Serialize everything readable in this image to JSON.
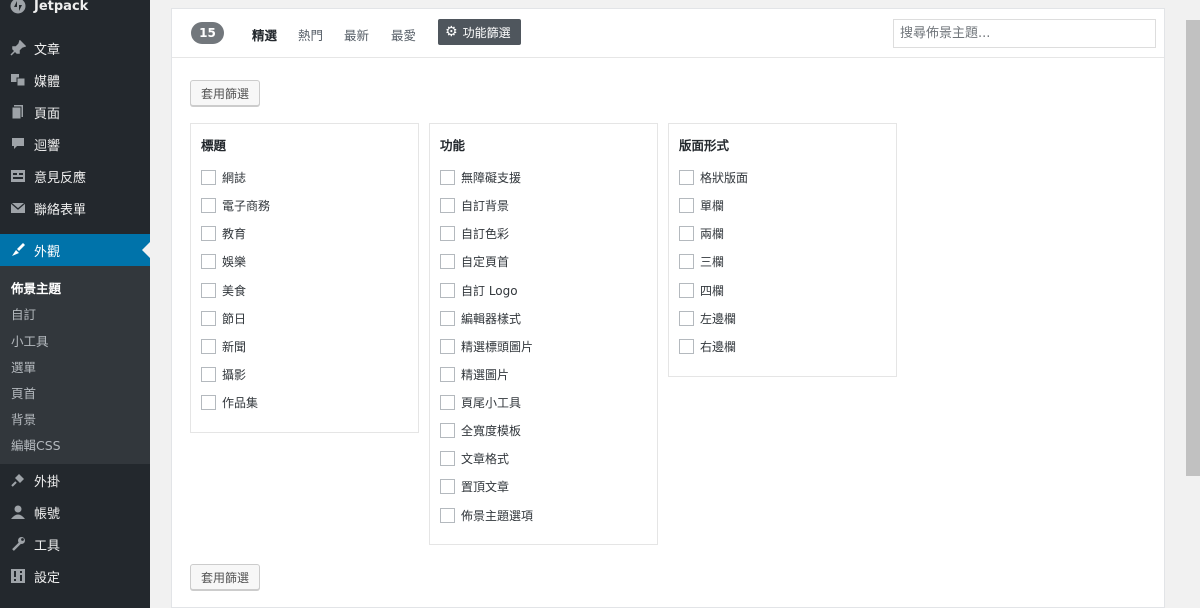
{
  "sidebar": {
    "jetpack": "Jetpack",
    "items": [
      {
        "label": "文章",
        "icon": "pin-icon"
      },
      {
        "label": "媒體",
        "icon": "media-icon"
      },
      {
        "label": "頁面",
        "icon": "page-icon"
      },
      {
        "label": "迴響",
        "icon": "comment-icon"
      },
      {
        "label": "意見反應",
        "icon": "feedback-icon"
      },
      {
        "label": "聯絡表單",
        "icon": "mail-icon"
      },
      {
        "label": "外觀",
        "icon": "appearance-icon"
      },
      {
        "label": "外掛",
        "icon": "plugin-icon"
      },
      {
        "label": "帳號",
        "icon": "user-icon"
      },
      {
        "label": "工具",
        "icon": "tools-icon"
      },
      {
        "label": "設定",
        "icon": "settings-icon"
      }
    ],
    "submenu": [
      "佈景主題",
      "自訂",
      "小工具",
      "選單",
      "頁首",
      "背景",
      "編輯CSS"
    ]
  },
  "filterbar": {
    "count": "15",
    "tabs": [
      "精選",
      "熱門",
      "最新",
      "最愛"
    ],
    "feature_filter": "功能篩選",
    "search_placeholder": "搜尋佈景主題..."
  },
  "apply_label": "套用篩選",
  "groups": [
    {
      "title": "標題",
      "options": [
        "網誌",
        "電子商務",
        "教育",
        "娛樂",
        "美食",
        "節日",
        "新聞",
        "攝影",
        "作品集"
      ]
    },
    {
      "title": "功能",
      "options": [
        "無障礙支援",
        "自訂背景",
        "自訂色彩",
        "自定頁首",
        "自訂 Logo",
        "編輯器樣式",
        "精選標頭圖片",
        "精選圖片",
        "頁尾小工具",
        "全寬度模板",
        "文章格式",
        "置頂文章",
        "佈景主題選項"
      ]
    },
    {
      "title": "版面形式",
      "options": [
        "格狀版面",
        "單欄",
        "兩欄",
        "三欄",
        "四欄",
        "左邊欄",
        "右邊欄"
      ]
    }
  ],
  "colors": {
    "sidebar_bg": "#23282d",
    "active_bg": "#0073aa",
    "badge_bg": "#72777c"
  }
}
